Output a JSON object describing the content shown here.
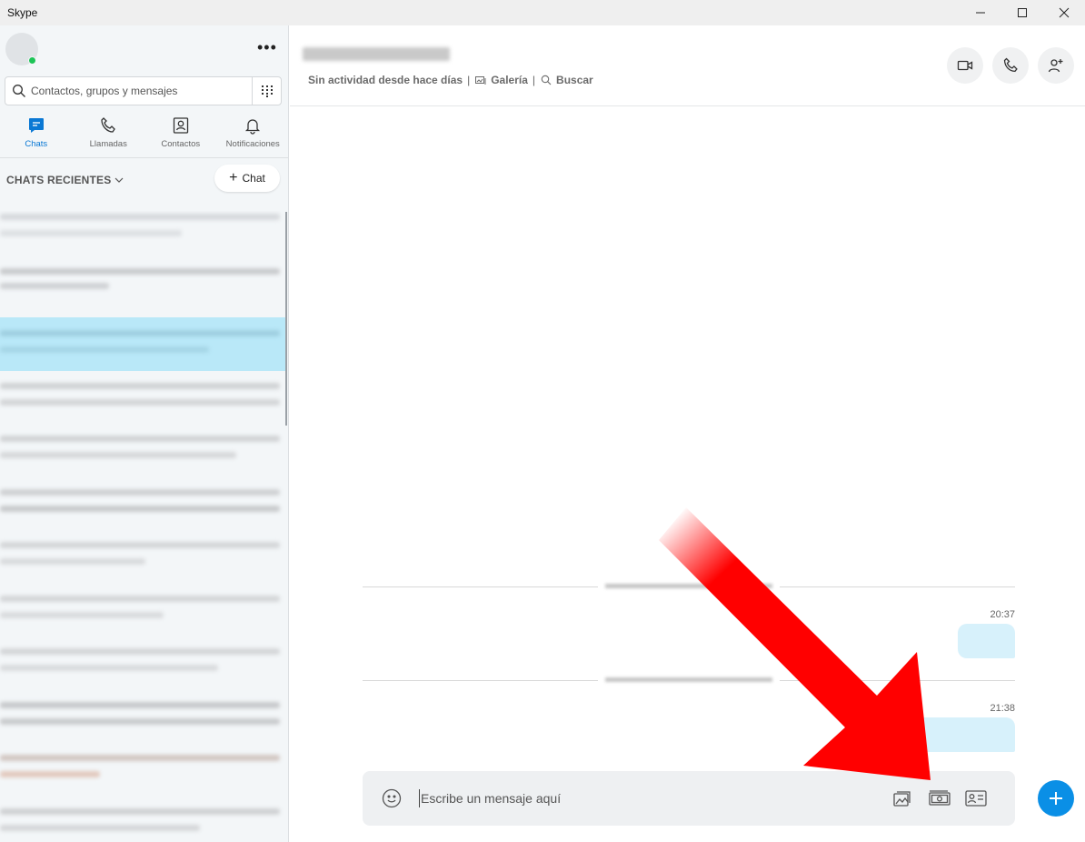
{
  "window": {
    "title": "Skype",
    "controls": [
      "minimize-icon",
      "maximize-icon",
      "close-icon"
    ]
  },
  "sidebar": {
    "more_label": "•••",
    "search": {
      "placeholder": "Contactos, grupos y mensajes",
      "value": ""
    },
    "tabs": [
      {
        "label": "Chats",
        "icon": "chat-icon",
        "active": true
      },
      {
        "label": "Llamadas",
        "icon": "phone-icon",
        "active": false
      },
      {
        "label": "Contactos",
        "icon": "contacts-icon",
        "active": false
      },
      {
        "label": "Notificaciones",
        "icon": "bell-icon",
        "active": false
      }
    ],
    "recent_header": "CHATS RECIENTES",
    "new_chat_label": "Chat"
  },
  "conversation": {
    "status": "Sin actividad desde hace días",
    "gallery_label": "Galería",
    "search_label": "Buscar",
    "messages": [
      {
        "time": "20:37"
      },
      {
        "time": "21:38"
      }
    ],
    "compose": {
      "placeholder": "Escribe un mensaje aquí",
      "value": ""
    }
  },
  "colors": {
    "accent": "#0a78d4",
    "presence_online": "#1dc456",
    "selected_chat": "#b9e8f8",
    "bubble": "#d7f1fb",
    "annotation_arrow": "#ff0000"
  }
}
